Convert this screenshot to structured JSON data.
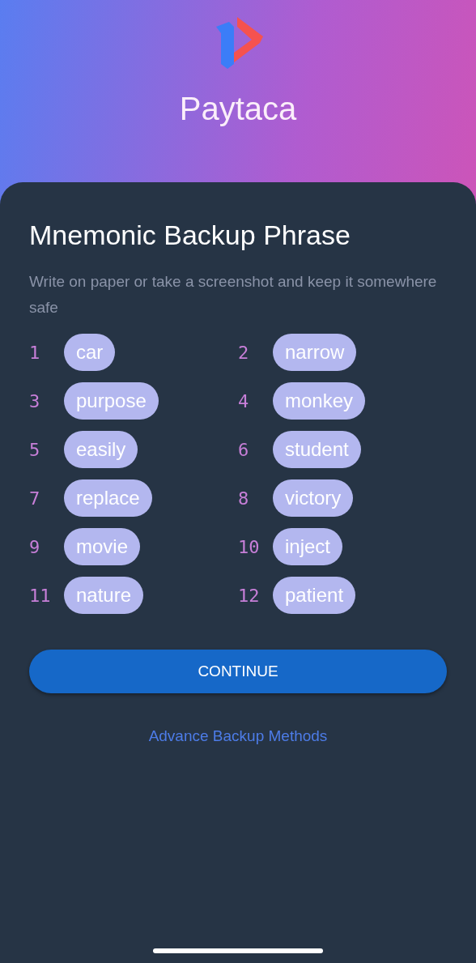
{
  "app": {
    "name": "Paytaca"
  },
  "backup": {
    "title": "Mnemonic Backup Phrase",
    "subtitle": "Write on paper or take a screenshot and keep it somewhere safe",
    "words": [
      {
        "number": "1",
        "word": "car"
      },
      {
        "number": "2",
        "word": "narrow"
      },
      {
        "number": "3",
        "word": "purpose"
      },
      {
        "number": "4",
        "word": "monkey"
      },
      {
        "number": "5",
        "word": "easily"
      },
      {
        "number": "6",
        "word": "student"
      },
      {
        "number": "7",
        "word": "replace"
      },
      {
        "number": "8",
        "word": "victory"
      },
      {
        "number": "9",
        "word": "movie"
      },
      {
        "number": "10",
        "word": "inject"
      },
      {
        "number": "11",
        "word": "nature"
      },
      {
        "number": "12",
        "word": "patient"
      }
    ],
    "continue_button": "CONTINUE",
    "advanced_link": "Advance Backup Methods"
  }
}
